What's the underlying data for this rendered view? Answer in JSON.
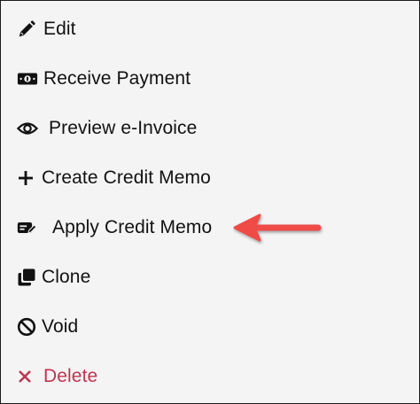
{
  "menu": {
    "items": [
      {
        "id": "edit",
        "label": "Edit",
        "icon": "pencil-icon"
      },
      {
        "id": "receive-payment",
        "label": "Receive Payment",
        "icon": "money-bill-icon"
      },
      {
        "id": "preview-einvoice",
        "label": "Preview e-Invoice",
        "icon": "eye-icon"
      },
      {
        "id": "create-credit-memo",
        "label": "Create Credit Memo",
        "icon": "plus-icon"
      },
      {
        "id": "apply-credit-memo",
        "label": "Apply Credit Memo",
        "icon": "memo-edit-icon"
      },
      {
        "id": "clone",
        "label": "Clone",
        "icon": "clone-icon"
      },
      {
        "id": "void",
        "label": "Void",
        "icon": "ban-icon"
      },
      {
        "id": "delete",
        "label": "Delete",
        "icon": "x-icon"
      }
    ]
  },
  "annotation": {
    "arrow_color": "#ef4c46",
    "points_to": "apply-credit-memo"
  },
  "colors": {
    "text": "#111111",
    "danger": "#c0354f",
    "background": "#f4f4f5"
  }
}
